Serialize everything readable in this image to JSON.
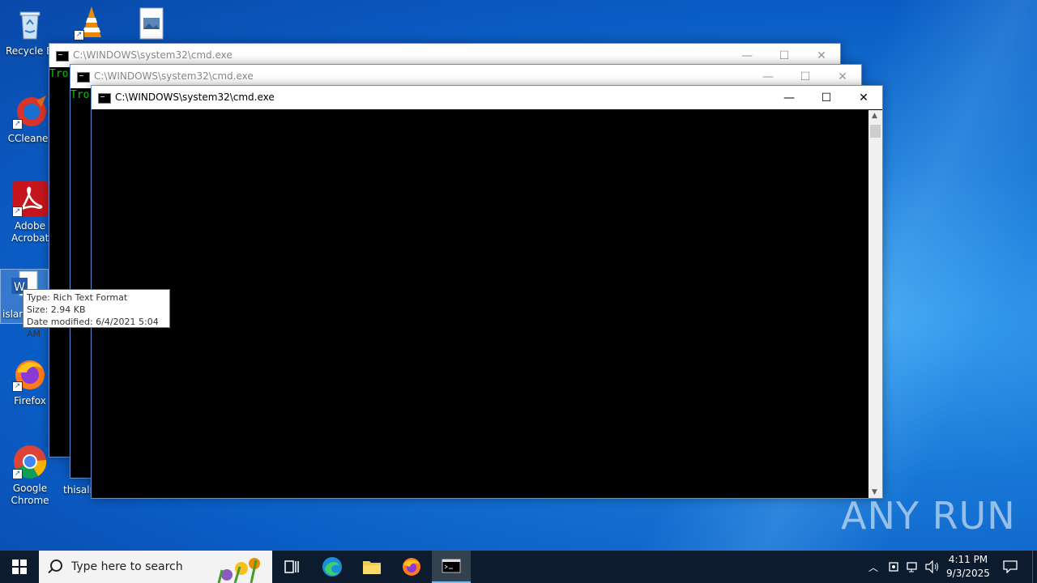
{
  "desktop": {
    "icons": [
      {
        "label": "Recycle Bin"
      },
      {
        "label": "CCleaner"
      },
      {
        "label": "Adobe Acrobat"
      },
      {
        "label": "islan"
      },
      {
        "label": "Firefox"
      },
      {
        "label": "Google Chrome"
      },
      {
        "label": "thisalr"
      }
    ],
    "tooltip": {
      "type": "Type: Rich Text Format",
      "size": "Size: 2.94 KB",
      "modified": "Date modified: 6/4/2021 5:04 AM"
    },
    "watermark": "ANY RUN"
  },
  "windows": [
    {
      "title": "C:\\WINDOWS\\system32\\cmd.exe",
      "output": "Tro"
    },
    {
      "title": "C:\\WINDOWS\\system32\\cmd.exe",
      "output": "Tro"
    },
    {
      "title": "C:\\WINDOWS\\system32\\cmd.exe",
      "output": ""
    }
  ],
  "window_controls": {
    "minimize": "—",
    "maximize": "☐",
    "close": "✕"
  },
  "taskbar": {
    "search_placeholder": "Type here to search",
    "clock_time": "4:11 PM",
    "clock_date": "9/3/2025"
  },
  "colors": {
    "console_text": "#13c613",
    "taskbar": "#0d1b2e"
  }
}
